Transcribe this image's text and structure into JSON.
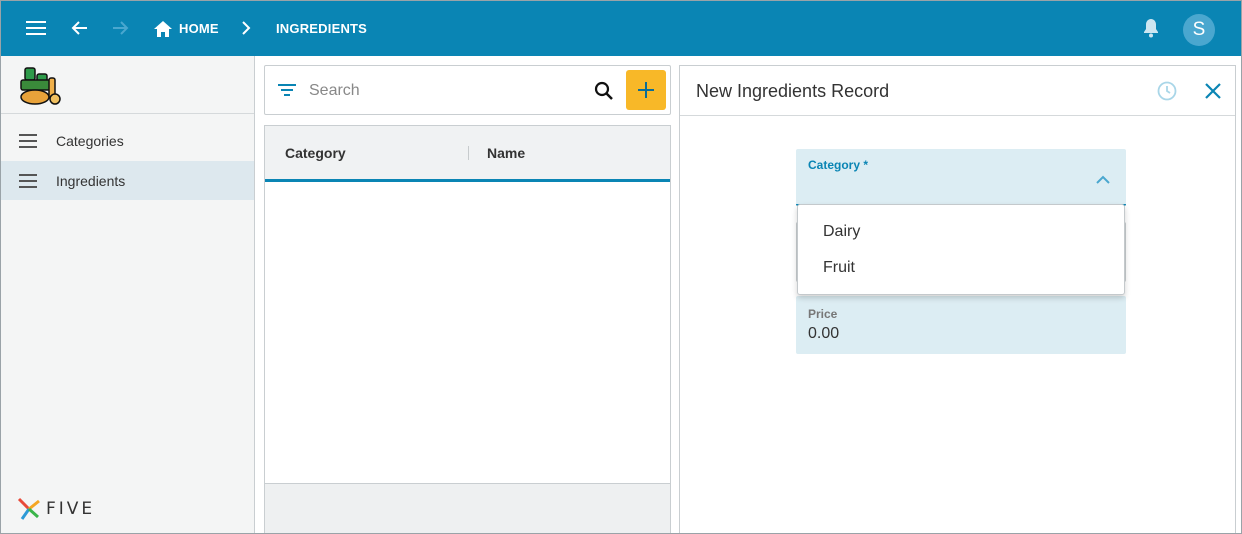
{
  "topbar": {
    "crumbs": [
      "HOME",
      "INGREDIENTS"
    ],
    "avatar_initial": "S",
    "icons": [
      "menu-icon",
      "back-arrow-icon",
      "forward-arrow-icon",
      "home-icon",
      "chevron-right-icon",
      "bell-icon"
    ]
  },
  "sidebar": {
    "items": [
      {
        "label": "Categories",
        "active": false
      },
      {
        "label": "Ingredients",
        "active": true
      }
    ],
    "brand": "FIVE"
  },
  "list": {
    "search_placeholder": "Search",
    "columns": [
      "Category",
      "Name"
    ],
    "rows": []
  },
  "form": {
    "title": "New Ingredients Record",
    "category_label": "Category *",
    "category_options": [
      "Dairy",
      "Fruit"
    ],
    "price_label": "Price",
    "price_value": "0.00"
  },
  "colors": {
    "primary": "#0a85b4",
    "accent": "#f8b828",
    "field_bg": "#dcedf3"
  }
}
